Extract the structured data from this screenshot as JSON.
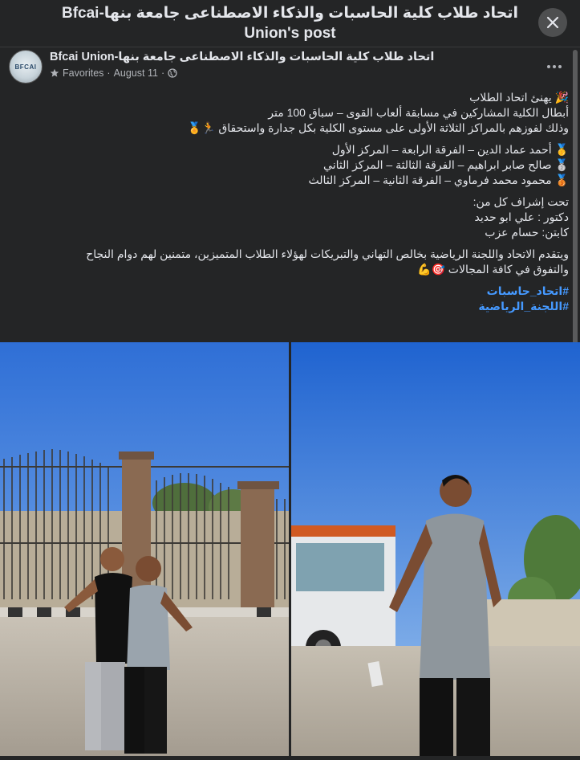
{
  "dialog": {
    "title": "Bfcai-اتحاد طلاب كلية الحاسبات والذكاء الاصطناعى جامعة بنها Union's post",
    "close_icon": "close-icon"
  },
  "post": {
    "page_name": "Bfcai Union-اتحاد طلاب كلية الحاسبات والذكاء الاصطناعى جامعة بنها",
    "avatar_text": "BFCAI",
    "meta": {
      "favorites": "Favorites",
      "separator": "·",
      "date": "August 11",
      "separator2": "·"
    },
    "lines": {
      "l1": "🎉 يهنئ اتحاد الطلاب",
      "l2": "أبطال الكلية المشاركين في مسابقة ألعاب القوى – سباق 100 متر",
      "l3": "وذلك لفوزهم بالمراكز الثلاثة الأولى على مستوى الكلية بكل جدارة واستحقاق 🏃🏅",
      "l4": "🥇 أحمد عماد الدين – الفرقة الرابعة – المركز الأول",
      "l5": "🥈 صالح صابر ابراهيم – الفرقة الثالثة – المركز الثاني",
      "l6": "🥉 محمود محمد فرماوي – الفرقة الثانية – المركز الثالث",
      "l7": "تحت إشراف كل من:",
      "l8": "دكتور : علي ابو حديد",
      "l9": "كابتن: حسام عزب",
      "l10": "ويتقدم الاتحاد واللجنة الرياضية بخالص التهاني والتبريكات لهؤلاء الطلاب المتميزين، متمنين لهم دوام النجاح",
      "l11": "والتفوق في كافة المجالات 🎯💪"
    },
    "hashtags": [
      "#اتحاد_حاسبات",
      "#اللجنة_الرياضية"
    ]
  }
}
